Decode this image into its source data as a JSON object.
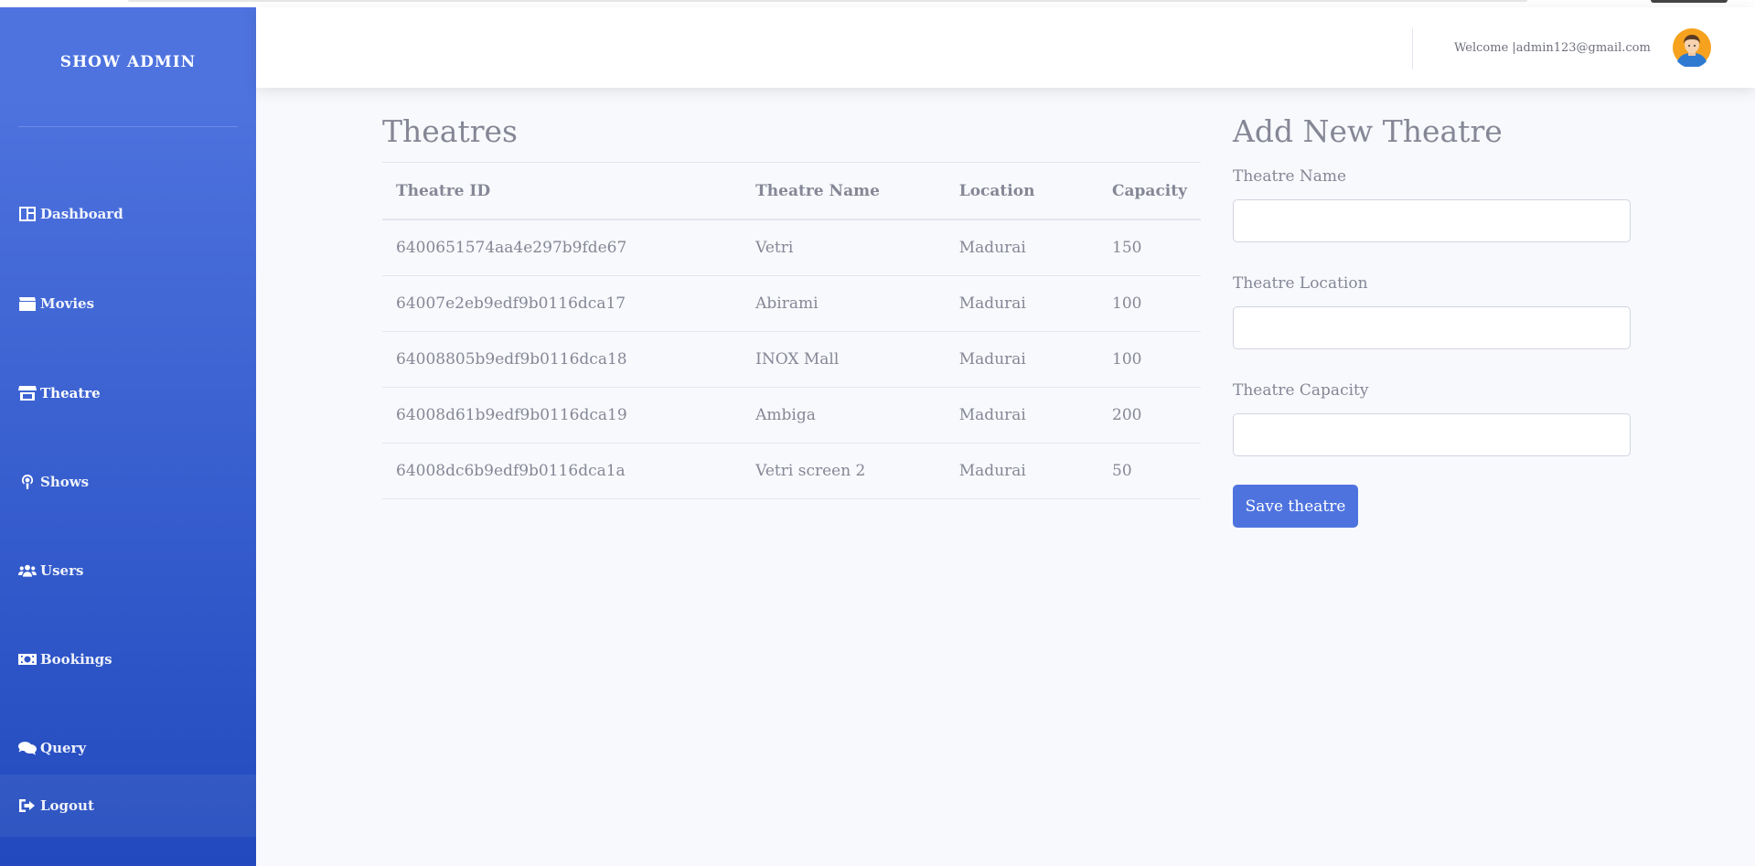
{
  "brand": "SHOW ADMIN",
  "sidebar": {
    "items": [
      {
        "label": "Dashboard",
        "icon": "dashboard-icon"
      },
      {
        "label": "Movies",
        "icon": "clapperboard-icon"
      },
      {
        "label": "Theatre",
        "icon": "store-icon"
      },
      {
        "label": "Shows",
        "icon": "podcast-icon"
      },
      {
        "label": "Users",
        "icon": "users-icon"
      },
      {
        "label": "Bookings",
        "icon": "money-icon"
      },
      {
        "label": "Query",
        "icon": "comments-icon"
      },
      {
        "label": "Logout",
        "icon": "sign-out-icon"
      }
    ],
    "active": "Theatre"
  },
  "topbar": {
    "welcome": "Welcome |admin123@gmail.com"
  },
  "theatres": {
    "title": "Theatres",
    "columns": [
      "Theatre ID",
      "Theatre Name",
      "Location",
      "Capacity"
    ],
    "rows": [
      [
        "6400651574aa4e297b9fde67",
        "Vetri",
        "Madurai",
        "150"
      ],
      [
        "64007e2eb9edf9b0116dca17",
        "Abirami",
        "Madurai",
        "100"
      ],
      [
        "64008805b9edf9b0116dca18",
        "INOX Mall",
        "Madurai",
        "100"
      ],
      [
        "64008d61b9edf9b0116dca19",
        "Ambiga",
        "Madurai",
        "200"
      ],
      [
        "64008dc6b9edf9b0116dca1a",
        "Vetri screen 2",
        "Madurai",
        "50"
      ]
    ]
  },
  "form": {
    "title": "Add New Theatre",
    "name_label": "Theatre Name",
    "name_value": "",
    "location_label": "Theatre Location",
    "location_value": "",
    "capacity_label": "Theatre Capacity",
    "capacity_value": "",
    "save_label": "Save theatre"
  },
  "colors": {
    "primary": "#4e73df",
    "sidebar_top": "#4e73df",
    "sidebar_bottom": "#224abe",
    "text_muted": "#858796"
  }
}
